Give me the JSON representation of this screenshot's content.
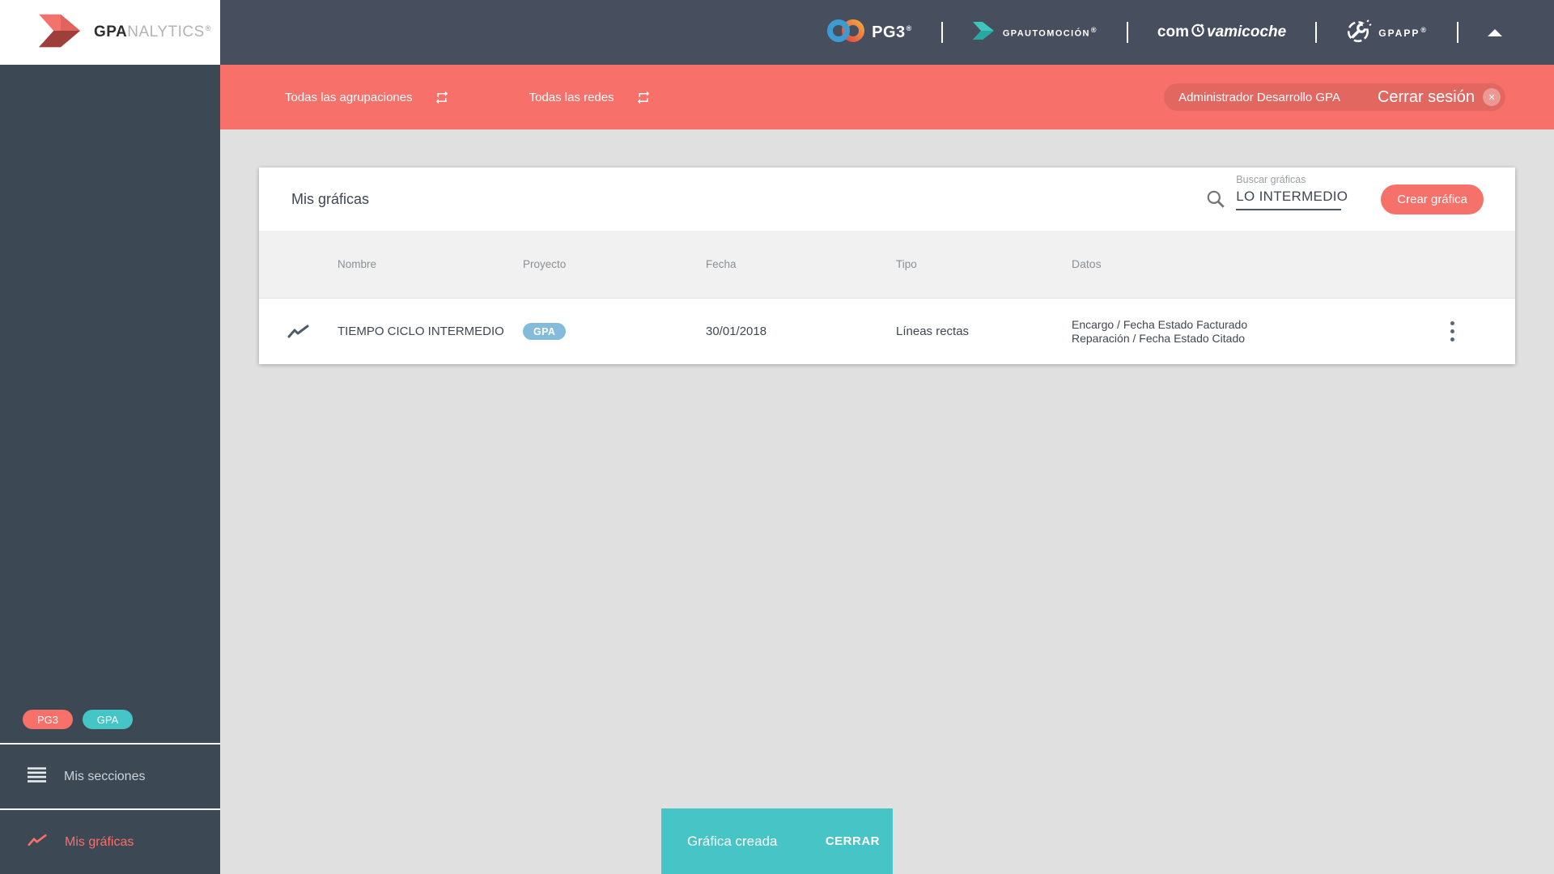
{
  "brand": {
    "gpa": "GPA",
    "nalytics": "NALYTICS",
    "registered": "®"
  },
  "topbar": {
    "pg3": "PG3",
    "automocion": "GPAUTOMOCIÓN",
    "com": "com",
    "vamicoche": "vamicoche",
    "gpapp": "GPAPP"
  },
  "filterbar": {
    "agrupaciones": "Todas las agrupaciones",
    "redes": "Todas las redes",
    "user": "Administrador Desarrollo GPA",
    "logout": "Cerrar sesión",
    "close_glyph": "✕"
  },
  "sidebar": {
    "badges": [
      {
        "label": "PG3",
        "color": "#f7706a"
      },
      {
        "label": "GPA",
        "color": "#45c5c5"
      }
    ],
    "items": [
      {
        "label": "Mis secciones",
        "icon": "menu-icon",
        "active": false
      },
      {
        "label": "Mis gráficas",
        "icon": "line-chart-icon",
        "active": true
      }
    ]
  },
  "main": {
    "title": "Mis gráficas",
    "search": {
      "label": "Buscar gráficas",
      "value": "LO INTERMEDIO"
    },
    "create_button": "Crear gráfica",
    "table": {
      "headers": [
        "Nombre",
        "Proyecto",
        "Fecha",
        "Tipo",
        "Datos"
      ],
      "rows": [
        {
          "nombre": "TIEMPO CICLO INTERMEDIO",
          "proyecto": "GPA",
          "fecha": "30/01/2018",
          "tipo": "Líneas rectas",
          "datos": [
            "Encargo / Fecha Estado Facturado",
            "Reparación / Fecha Estado Citado"
          ]
        }
      ]
    }
  },
  "snackbar": {
    "message": "Gráfica creada",
    "action": "CERRAR"
  },
  "colors": {
    "coral": "#f7706a",
    "navy_topbar": "#474f5f",
    "sidebar_dark": "#3c4854",
    "teal_snackbar": "#46c4c6",
    "teal_badge": "#45c5c5",
    "blue_table_badge": "#85bbda",
    "main_background": "#e0e0e0"
  },
  "icons": {
    "search": "magnifier",
    "swap": "repeat-arrows",
    "menu": "hamburger",
    "chart": "zigzag-line",
    "more": "vertical-dots",
    "close": "x-in-circle",
    "collapse": "triangle-up",
    "clock": "clock",
    "wrench": "wrench-in-dashed-circle",
    "infinity": "two-loop-infinity",
    "arrow": "ribbon-arrow"
  }
}
